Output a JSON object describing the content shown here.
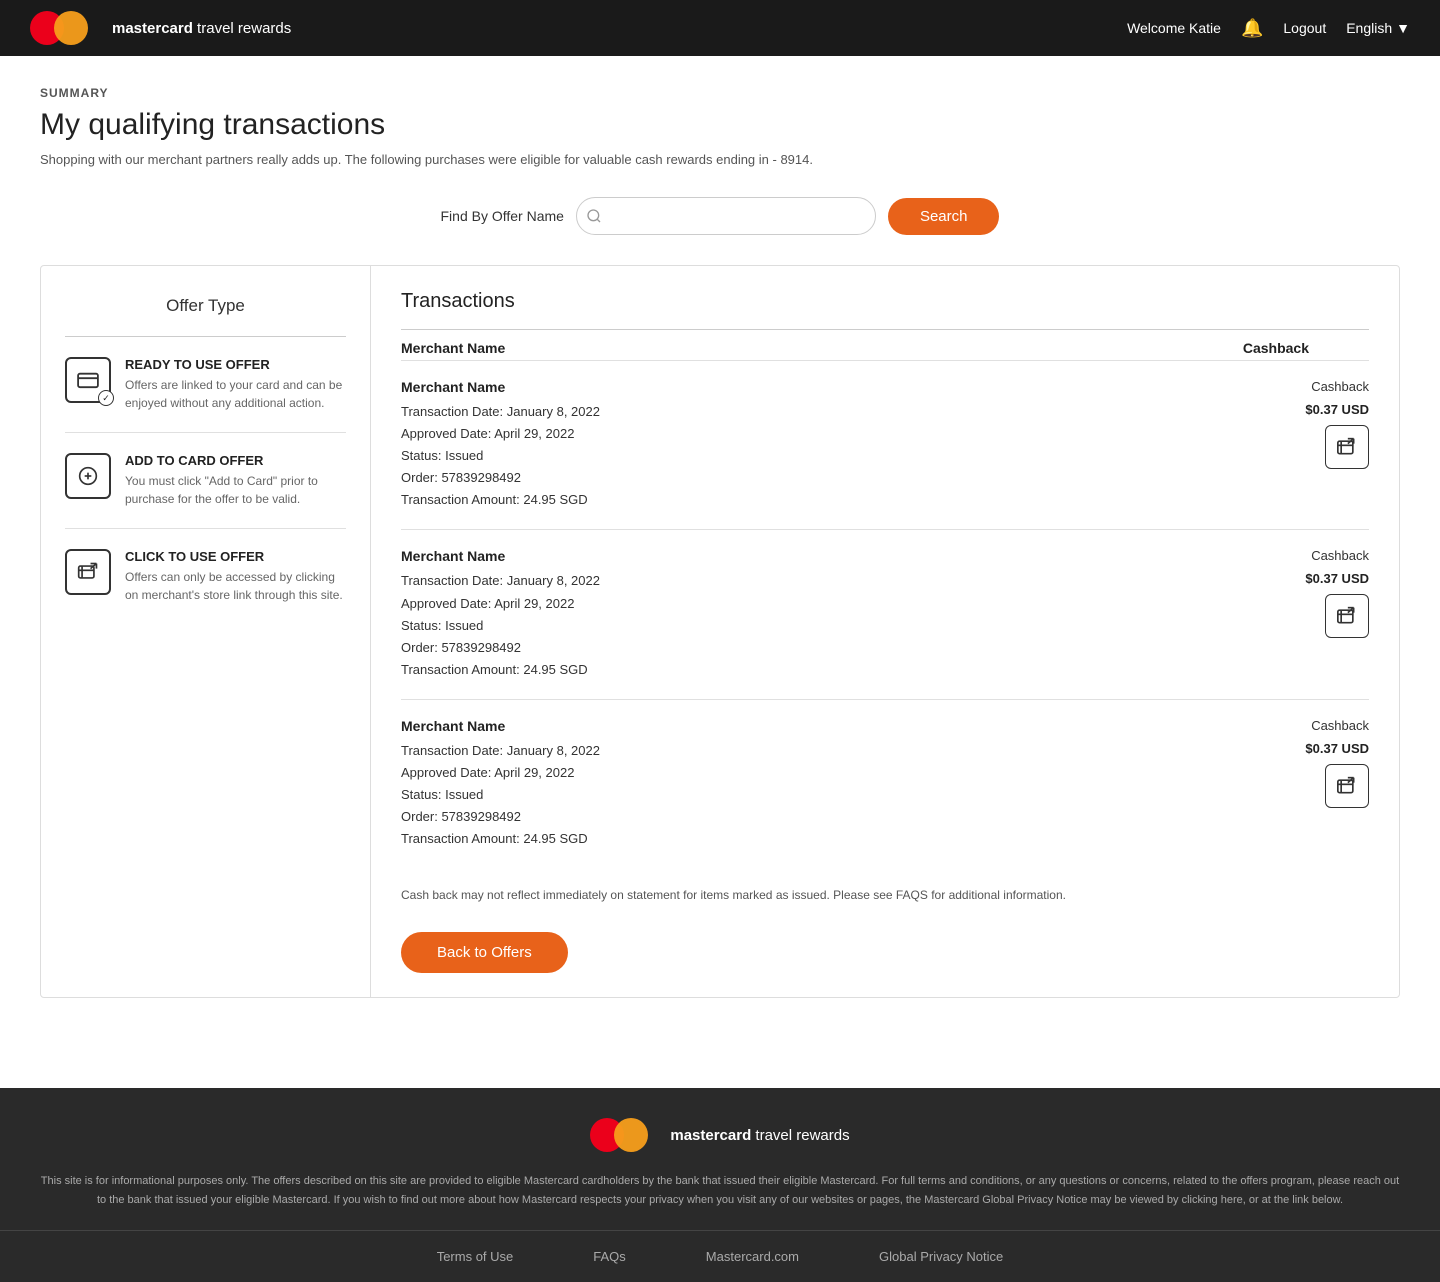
{
  "header": {
    "brand": "mastercard",
    "brand_suffix": " travel rewards",
    "welcome": "Welcome Katie",
    "logout": "Logout",
    "language": "English"
  },
  "page": {
    "summary_label": "SUMMARY",
    "title": "My qualifying transactions",
    "description": "Shopping with our merchant partners really adds up. The following purchases were eligible for valuable cash rewards ending in - 8914."
  },
  "search": {
    "label": "Find By Offer Name",
    "placeholder": "",
    "button": "Search"
  },
  "offer_type": {
    "title": "Offer Type",
    "items": [
      {
        "id": "ready",
        "title": "READY TO USE OFFER",
        "description": "Offers are linked to your card and can be enjoyed without any additional action."
      },
      {
        "id": "add_to_card",
        "title": "ADD TO CARD OFFER",
        "description": "You must click \"Add to Card\" prior to purchase for the offer to be valid."
      },
      {
        "id": "click_to_use",
        "title": "CLICK TO USE OFFER",
        "description": "Offers can only be accessed by clicking on merchant's store link through this site."
      }
    ]
  },
  "transactions": {
    "title": "Transactions",
    "columns": {
      "merchant_name": "Merchant Name",
      "cashback": "Cashback"
    },
    "rows": [
      {
        "merchant": "Merchant Name",
        "cashback_label": "Cashback",
        "cashback_amount": "$0.37 USD",
        "transaction_date": "Transaction Date: January 8, 2022",
        "approved_date": "Approved Date: April 29, 2022",
        "status": "Status: Issued",
        "order": "Order: 57839298492",
        "amount": "Transaction Amount: 24.95 SGD"
      },
      {
        "merchant": "Merchant Name",
        "cashback_label": "Cashback",
        "cashback_amount": "$0.37 USD",
        "transaction_date": "Transaction Date: January 8, 2022",
        "approved_date": "Approved Date: April 29, 2022",
        "status": "Status: Issued",
        "order": "Order: 57839298492",
        "amount": "Transaction Amount: 24.95 SGD"
      },
      {
        "merchant": "Merchant Name",
        "cashback_label": "Cashback",
        "cashback_amount": "$0.37 USD",
        "transaction_date": "Transaction Date: January 8, 2022",
        "approved_date": "Approved Date: April 29, 2022",
        "status": "Status: Issued",
        "order": "Order: 57839298492",
        "amount": "Transaction Amount: 24.95 SGD"
      }
    ],
    "disclaimer": "Cash back may not reflect immediately on statement for items marked as issued. Please see FAQS for additional information.",
    "back_button": "Back to Offers"
  },
  "footer": {
    "brand": "mastercard",
    "brand_suffix": " travel rewards",
    "disclaimer": "This site is for informational purposes only. The offers described on this site are provided to eligible Mastercard cardholders by the bank that issued their eligible Mastercard. For full terms and conditions, or any questions or concerns, related to the offers program, please reach out to the bank that issued your eligible Mastercard. If you wish to find out more about how Mastercard respects your privacy when you visit any of our websites or pages, the Mastercard Global Privacy Notice may be viewed by clicking here, or at the link below.",
    "links": [
      {
        "label": "Terms of Use"
      },
      {
        "label": "FAQs"
      },
      {
        "label": "Mastercard.com"
      },
      {
        "label": "Global Privacy Notice"
      }
    ]
  }
}
